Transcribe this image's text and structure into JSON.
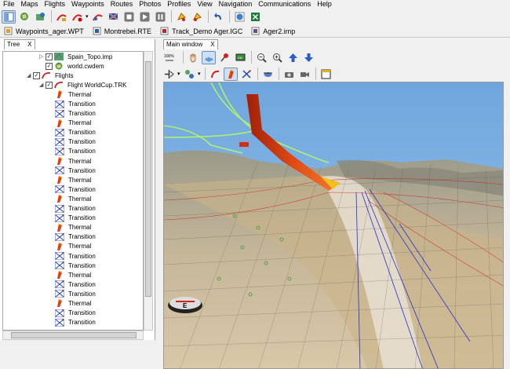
{
  "menu": [
    "File",
    "Maps",
    "Flights",
    "Waypoints",
    "Routes",
    "Photos",
    "Profiles",
    "View",
    "Navigation",
    "Communications",
    "Help"
  ],
  "toolbar": {
    "icons": [
      "layout-icon",
      "map-open-icon",
      "map-tools-icon",
      "flight-open-icon",
      "flight-record-icon",
      "flight-track-icon",
      "flag-icon",
      "stop-icon",
      "play-icon",
      "pause-icon",
      "fuel-icon",
      "forward-icon",
      "undo-icon",
      "web-icon",
      "spreadsheet-icon"
    ]
  },
  "file_tabs": [
    {
      "label": "Waypoints_ager.WPT",
      "icon": "waypoints-file-icon"
    },
    {
      "label": "Montrebei.RTE",
      "icon": "route-file-icon"
    },
    {
      "label": "Track_Demo Ager.IGC",
      "icon": "track-file-icon"
    },
    {
      "label": "Ager2.imp",
      "icon": "image-file-icon"
    }
  ],
  "tree": {
    "tab_label": "Tree",
    "close": "X",
    "rows": [
      {
        "label": "Spain_Topo.imp",
        "indent": 3,
        "type": "map"
      },
      {
        "label": "world.cwdem",
        "indent": 3,
        "type": "dem"
      },
      {
        "label": "Flights",
        "indent": 2,
        "type": "flights"
      },
      {
        "label": "Flight WorldCup.TRK",
        "indent": 3,
        "type": "flight"
      },
      {
        "label": "Thermal",
        "indent": 4,
        "type": "thermal"
      },
      {
        "label": "Transition",
        "indent": 4,
        "type": "transition"
      },
      {
        "label": "Transition",
        "indent": 4,
        "type": "transition"
      },
      {
        "label": "Thermal",
        "indent": 4,
        "type": "thermal"
      },
      {
        "label": "Transition",
        "indent": 4,
        "type": "transition"
      },
      {
        "label": "Transition",
        "indent": 4,
        "type": "transition"
      },
      {
        "label": "Transition",
        "indent": 4,
        "type": "transition"
      },
      {
        "label": "Thermal",
        "indent": 4,
        "type": "thermal"
      },
      {
        "label": "Transition",
        "indent": 4,
        "type": "transition"
      },
      {
        "label": "Thermal",
        "indent": 4,
        "type": "thermal"
      },
      {
        "label": "Transition",
        "indent": 4,
        "type": "transition"
      },
      {
        "label": "Thermal",
        "indent": 4,
        "type": "thermal"
      },
      {
        "label": "Transition",
        "indent": 4,
        "type": "transition"
      },
      {
        "label": "Transition",
        "indent": 4,
        "type": "transition"
      },
      {
        "label": "Thermal",
        "indent": 4,
        "type": "thermal"
      },
      {
        "label": "Transition",
        "indent": 4,
        "type": "transition"
      },
      {
        "label": "Thermal",
        "indent": 4,
        "type": "thermal"
      },
      {
        "label": "Transition",
        "indent": 4,
        "type": "transition"
      },
      {
        "label": "Transition",
        "indent": 4,
        "type": "transition"
      },
      {
        "label": "Thermal",
        "indent": 4,
        "type": "thermal"
      },
      {
        "label": "Transition",
        "indent": 4,
        "type": "transition"
      },
      {
        "label": "Transition",
        "indent": 4,
        "type": "transition"
      },
      {
        "label": "Thermal",
        "indent": 4,
        "type": "thermal"
      },
      {
        "label": "Transition",
        "indent": 4,
        "type": "transition"
      },
      {
        "label": "Transition",
        "indent": 4,
        "type": "transition"
      }
    ]
  },
  "main": {
    "tab_label": "Main window",
    "close": "X",
    "zoom_badge": "100%",
    "compass_letter": "E"
  },
  "colors": {
    "sky": "#7aaee0",
    "track": "#d03b14",
    "track_glow": "#f0c020",
    "route": "#b0f070",
    "grid_blue": "#2030d0",
    "grid_red": "#d02020"
  }
}
